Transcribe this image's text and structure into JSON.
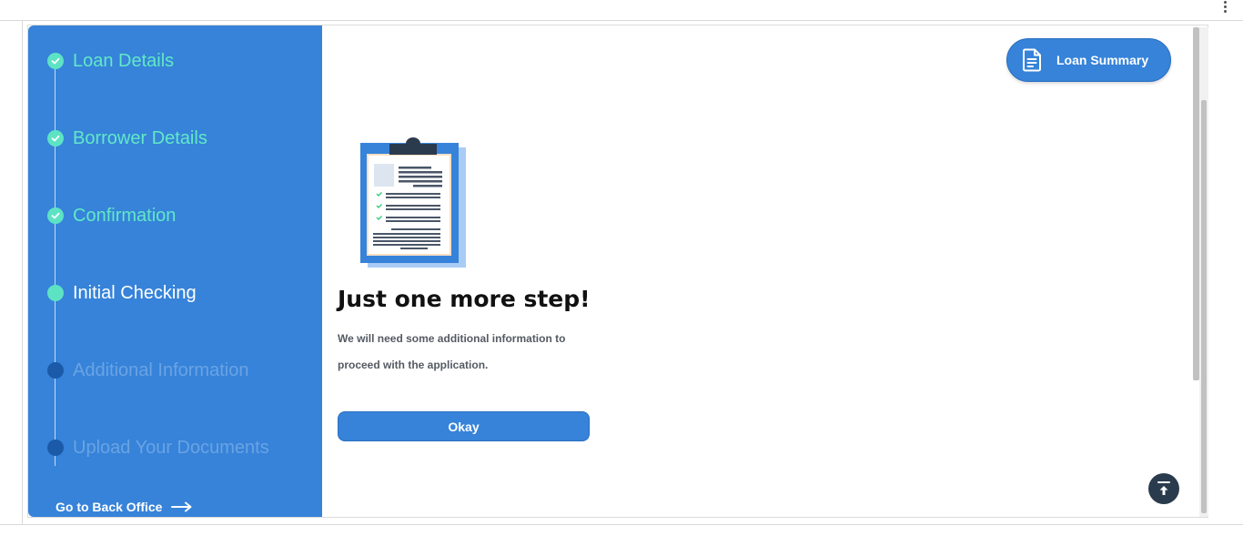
{
  "sidebar": {
    "steps": [
      {
        "label": "Loan Details",
        "status": "done"
      },
      {
        "label": "Borrower Details",
        "status": "done"
      },
      {
        "label": "Confirmation",
        "status": "done"
      },
      {
        "label": "Initial Checking",
        "status": "current"
      },
      {
        "label": "Additional Information",
        "status": "pending"
      },
      {
        "label": "Upload Your Documents",
        "status": "pending"
      }
    ],
    "back_office_label": "Go to Back Office"
  },
  "header": {
    "summary_button_label": "Loan Summary"
  },
  "main": {
    "heading": "Just one more step!",
    "description": "We will need some additional information to proceed with the application.",
    "okay_button_label": "Okay"
  },
  "colors": {
    "primary": "#3683d9",
    "done": "#62e8c7",
    "pending": "#6aa3e4",
    "scroll_top": "#2b3b4e"
  },
  "icons": {
    "step_done": "check-icon",
    "summary": "document-icon",
    "back_office": "arrow-right-icon",
    "scroll_top": "arrow-up-to-line-icon",
    "menu": "kebab-menu-icon"
  }
}
